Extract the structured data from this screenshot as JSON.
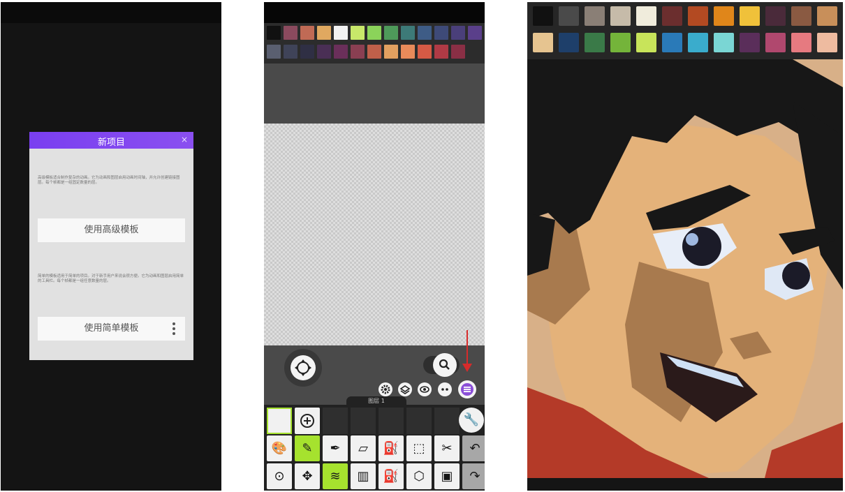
{
  "panel_new_project": {
    "title": "新项目",
    "close_label": "×",
    "advanced_description": "高级模板适合制作复杂的动画。它为动画和图层启用动画时间轴，并允许创建链接图层。每个帧都是一组固定数量的层。",
    "advanced_button_label": "使用高级模板",
    "simple_description": "简单的模板适用于简单的项目。对于新手用户来说会很方便。它为动画和图层启用简单的工具栏。每个帧都是一组任意数量的层。",
    "simple_button_label": "使用简单模板"
  },
  "panel_editor": {
    "palette_row1": [
      "#111111",
      "#8b4a5e",
      "#c06a55",
      "#e0a860",
      "#f2f2f2",
      "#c8e86a",
      "#8bd35a",
      "#4e9a5a",
      "#3d7a78",
      "#3e5c86",
      "#3e4a78",
      "#4a3f7a",
      "#5a3f8a"
    ],
    "palette_row2": [
      "#5a5f70",
      "#3f4358",
      "#2f2f44",
      "#4a2f55",
      "#6a2f5a",
      "#8a3f52",
      "#c0604a",
      "#e2a060",
      "#e88a5a",
      "#d65a45",
      "#b03a45",
      "#8a2f45"
    ],
    "layer_tab_label": "图层 1",
    "tools_row1": [
      {
        "name": "palette-icon",
        "glyph": "🎨"
      },
      {
        "name": "pencil-icon",
        "glyph": "✎"
      },
      {
        "name": "eyedropper-icon",
        "glyph": "✒"
      },
      {
        "name": "eraser-icon",
        "glyph": "▱"
      },
      {
        "name": "fill-bucket-icon",
        "glyph": "⛽"
      },
      {
        "name": "selection-icon",
        "glyph": "⬚"
      },
      {
        "name": "tools-icon",
        "glyph": "✂"
      },
      {
        "name": "undo-icon",
        "glyph": "↶"
      }
    ],
    "tools_row2": [
      {
        "name": "zoom-tool-icon",
        "glyph": "⊙"
      },
      {
        "name": "move-icon",
        "glyph": "✥"
      },
      {
        "name": "layers-icon",
        "glyph": "≋"
      },
      {
        "name": "frames-icon",
        "glyph": "▥"
      },
      {
        "name": "lock-fill-icon",
        "glyph": "⛽"
      },
      {
        "name": "shape-icon",
        "glyph": "⬡"
      },
      {
        "name": "image-import-icon",
        "glyph": "▣"
      },
      {
        "name": "redo-icon",
        "glyph": "↷"
      }
    ],
    "accent_color": "#a6e22e",
    "menu_icon_color": "#8b4fd8",
    "annotation_arrow_color": "#d72b2b"
  },
  "panel_pixel_art": {
    "palette_row1": [
      "#111111",
      "#4a4a4a",
      "#8a7f76",
      "#c6bba9",
      "#f0ecdc",
      "#6b2e2e",
      "#b34a22",
      "#e0861a",
      "#f0c13a",
      "#4a2a3a",
      "#8a5a42",
      "#c88f5a"
    ],
    "palette_row2": [
      "#e6c490",
      "#1e3f6a",
      "#3a7a48",
      "#74b43a",
      "#c8e45a",
      "#2a7ab8",
      "#3aaccc",
      "#7ad6d4",
      "#5a2e5a",
      "#b0486e",
      "#e67a80",
      "#eebba0"
    ],
    "colors": {
      "hair": "#171717",
      "skin": "#e4b27a",
      "skin_shadow": "#a87a4e",
      "shirt": "#b43a28",
      "background": "#d8b088"
    }
  }
}
